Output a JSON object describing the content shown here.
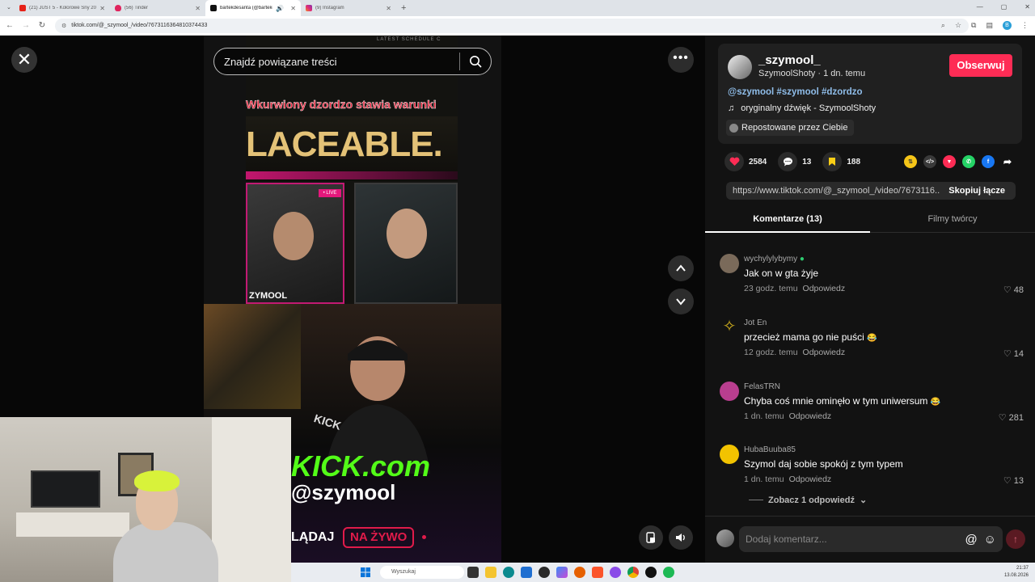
{
  "browser": {
    "tabs": [
      {
        "title": "(21) JUST 5 - Kolorowe Sny 202...",
        "color": "#e62117"
      },
      {
        "title": "(56) Tinder",
        "color": "#e0245e"
      },
      {
        "title": "bartekdesanta (@bartekdes...",
        "color": "#111111",
        "active": true
      },
      {
        "title": "(9) Instagram",
        "color": "#c13584"
      }
    ],
    "url": "tiktok.com/@_szymool_/video/7673116364810374433"
  },
  "video": {
    "search_placeholder": "Znajdź powiązane treści",
    "top_tabs": "LATEST   SCHEDULE   C",
    "caption": "Wkurwiony dzordzo stawia warunki",
    "headline": "LACEABLE.",
    "live_tag": "• LIVE",
    "photo_name": "ZYMOOL",
    "kick_line1": "KICK.com",
    "kick_line2": "@szymool",
    "watch_label": "LĄDAJ",
    "live_label": "NA ŻYWO",
    "jersey_text": "KICK"
  },
  "author": {
    "username": "_szymool_",
    "meta": "SzymoolShoty · 1 dn. temu",
    "follow_label": "Obserwuj",
    "hashtags": "@szymool #szymool #dzordzo",
    "sound": "oryginalny dźwięk - SzymoolShoty",
    "repost": "Repostowane przez Ciebie"
  },
  "stats": {
    "likes": "2584",
    "comments": "13",
    "saves": "188"
  },
  "share": {
    "link": "https://www.tiktok.com/@_szymool_/video/7673116...",
    "copy_label": "Skopiuj łącze"
  },
  "comment_tabs": {
    "comments": "Komentarze (13)",
    "creator_videos": "Filmy twórcy"
  },
  "comments": [
    {
      "name": "wychylylybymy",
      "text": "Jak on w gta żyje",
      "time": "23 godz. temu",
      "reply": "Odpowiedz",
      "likes": "48",
      "avatar_color": "#7a6a5a"
    },
    {
      "name": "Jot En",
      "text": "przecież mama go nie puści",
      "time": "12 godz. temu",
      "reply": "Odpowiedz",
      "likes": "14",
      "avatar_color": "#d4b21e"
    },
    {
      "name": "FelasTRN",
      "text": "Chyba coś mnie ominęło w tym uniwersum",
      "time": "1 dn. temu",
      "reply": "Odpowiedz",
      "likes": "281",
      "avatar_color": "#b93e8f"
    },
    {
      "name": "HubaBuuba85",
      "text": "Szymol daj sobie spokój z tym typem",
      "time": "1 dn. temu",
      "reply": "Odpowiedz",
      "likes": "13",
      "avatar_color": "#f2c300"
    }
  ],
  "more_replies": "Zobacz 1 odpowiedź",
  "comment_input": {
    "placeholder": "Dodaj komentarz..."
  },
  "taskbar": {
    "search": "Wyszukaj",
    "time": "21:37",
    "date": "13.08.2026"
  }
}
